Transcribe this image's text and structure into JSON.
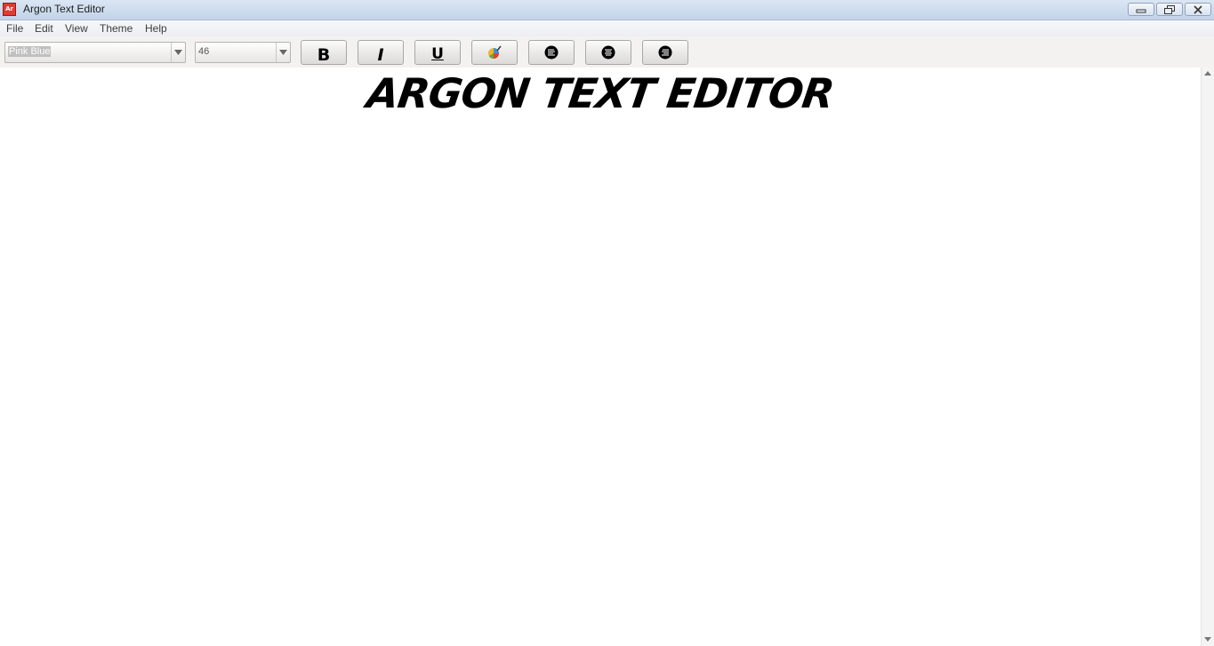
{
  "window": {
    "title": "Argon Text Editor",
    "icon_label": "Ar",
    "icon_color": "#e03c31"
  },
  "menu": {
    "items": [
      {
        "label": "File"
      },
      {
        "label": "Edit"
      },
      {
        "label": "View"
      },
      {
        "label": "Theme"
      },
      {
        "label": "Help"
      }
    ]
  },
  "toolbar": {
    "font_combo": {
      "value": "Pink Blue"
    },
    "size_combo": {
      "value": "46"
    },
    "bold_label": "B",
    "italic_label": "I",
    "underline_label": "U",
    "color_icon": "palette-icon",
    "align_left_icon": "align-left-icon",
    "align_center_icon": "align-center-icon",
    "align_right_icon": "align-right-icon"
  },
  "editor": {
    "text": "ARGON TEXT EDITOR"
  }
}
